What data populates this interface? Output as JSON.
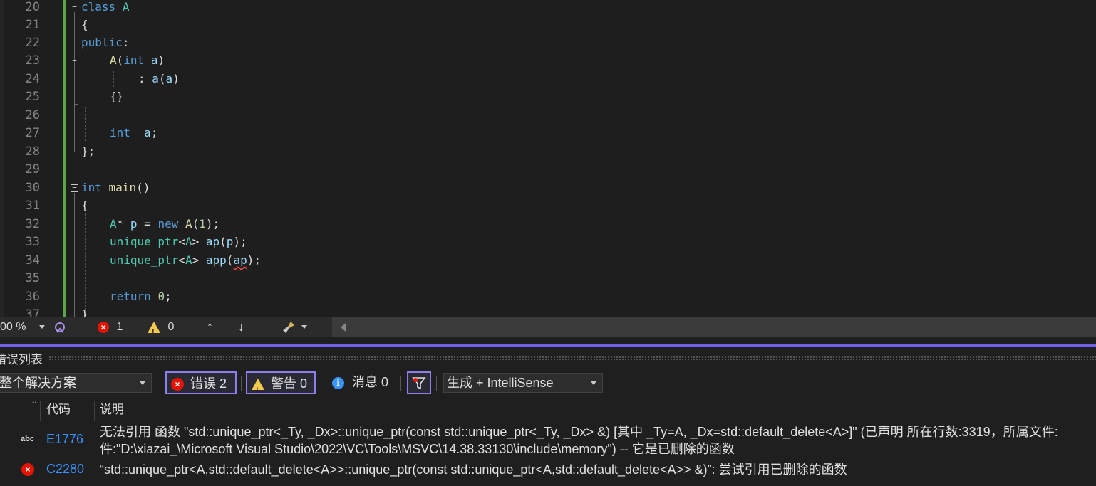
{
  "editor": {
    "line_numbers": [
      "20",
      "21",
      "22",
      "23",
      "24",
      "25",
      "26",
      "27",
      "28",
      "29",
      "30",
      "31",
      "32",
      "33",
      "34",
      "35",
      "36",
      "37"
    ],
    "code": {
      "l20": {
        "kw": "class",
        "name": "A"
      },
      "l21": "{",
      "l22": {
        "kw": "public",
        "colon": ":"
      },
      "l23": {
        "fn": "A",
        "open": "(",
        "kw": "int",
        "param": " a",
        "close": ")"
      },
      "l24": {
        "prefix": ":",
        "member": "_a",
        "open": "(",
        "arg": "a",
        "close": ")"
      },
      "l25": "{}",
      "l27": {
        "kw": "int",
        "member": " _a",
        "semi": ";"
      },
      "l28": "};",
      "l30": {
        "kw": "int",
        "fn": " main",
        "parens": "()"
      },
      "l31": "{",
      "l32": {
        "type": "A",
        "star": "* ",
        "var": "p",
        "eq": " = ",
        "kw": "new",
        "sp": " ",
        "fn": "A",
        "open": "(",
        "num": "1",
        "close": ");"
      },
      "l33": {
        "tmpl": "unique_ptr",
        "lt": "<",
        "targ": "A",
        "gt": ">",
        "sp": " ",
        "var": "ap",
        "open": "(",
        "arg": "p",
        "close": ");"
      },
      "l34": {
        "tmpl": "unique_ptr",
        "lt": "<",
        "targ": "A",
        "gt": ">",
        "sp": " ",
        "var": "app",
        "open": "(",
        "arg": "ap",
        "close": ");"
      },
      "l36": {
        "kw": "return",
        "sp": " ",
        "num": "0",
        "semi": ";"
      },
      "l37": "}"
    }
  },
  "editor_status": {
    "zoom": "00 %",
    "error_count": "1",
    "warning_count": "0"
  },
  "error_list": {
    "title": "错误列表",
    "scope": "整个解决方案",
    "errors_btn": "错误 2",
    "warnings_btn": "警告 0",
    "messages_btn": "消息 0",
    "source_filter": "生成 + IntelliSense",
    "columns": {
      "code": "代码",
      "desc": "说明"
    },
    "rows": [
      {
        "icon": "intellisense-error-icon",
        "code": "E1776",
        "desc_line1": "无法引用 函数 \"std::unique_ptr<_Ty, _Dx>::unique_ptr(const std::unique_ptr<_Ty, _Dx> &) [其中 _Ty=A, _Dx=std::default_delete<A>]\" (已声明 所在行数:3319，所属文件:",
        "desc_line2": "件:\"D:\\xiazai_\\Microsoft Visual Studio\\2022\\VC\\Tools\\MSVC\\14.38.33130\\include\\memory\") -- 它是已删除的函数"
      },
      {
        "icon": "error-icon",
        "code": "C2280",
        "desc_line1": "“std::unique_ptr<A,std::default_delete<A>>::unique_ptr(const std::unique_ptr<A,std::default_delete<A>> &)”: 尝试引用已删除的函数"
      }
    ]
  },
  "colors": {
    "keyword": "#569cd6",
    "type": "#4ec9b0",
    "function": "#dcdcaa",
    "identifier": "#9cdcfe",
    "number": "#b5cea8",
    "error": "#e51400",
    "warning": "#f2c94c",
    "accent": "#7160e8",
    "change_bar": "#57a64a"
  }
}
